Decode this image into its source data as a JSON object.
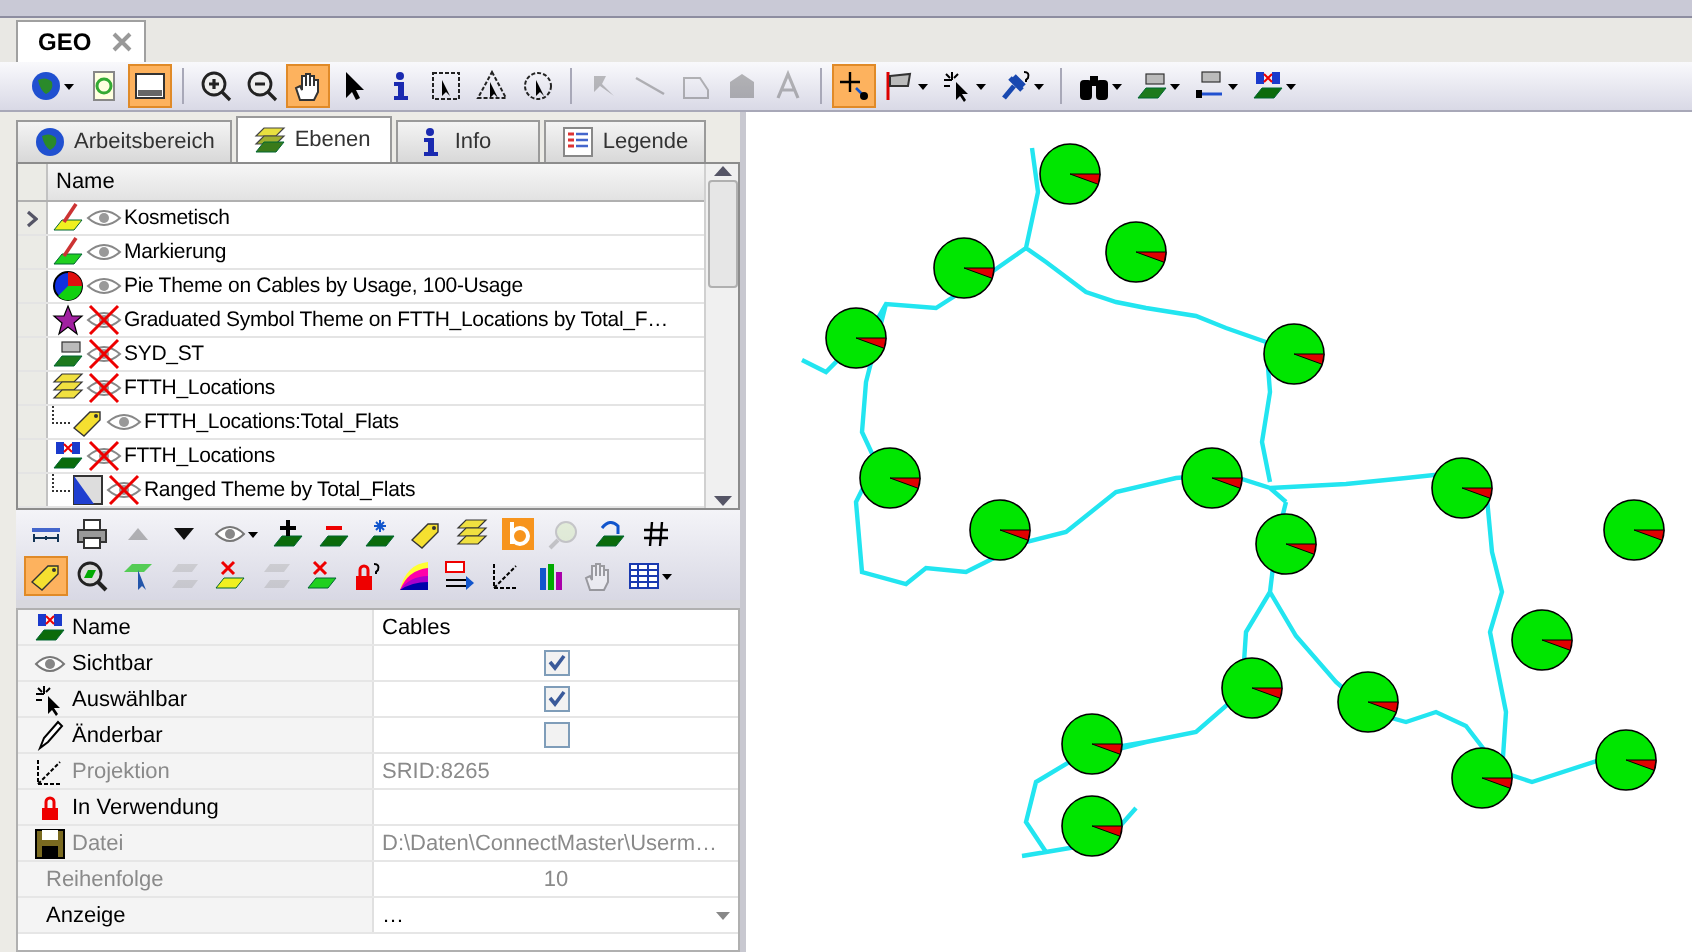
{
  "document_tab": {
    "title": "GEO",
    "selected": true
  },
  "main_toolbar": [
    {
      "kind": "globe",
      "on": false,
      "disabled": false,
      "dropdown": true
    },
    {
      "kind": "refresh",
      "on": false,
      "disabled": false,
      "dropdown": false
    },
    {
      "kind": "window",
      "on": true,
      "disabled": false,
      "dropdown": false
    },
    {
      "kind": "sep"
    },
    {
      "kind": "zoom-in",
      "on": false,
      "disabled": false,
      "dropdown": false
    },
    {
      "kind": "zoom-out",
      "on": false,
      "disabled": false,
      "dropdown": false
    },
    {
      "kind": "hand",
      "on": true,
      "disabled": false,
      "dropdown": false
    },
    {
      "kind": "pointer",
      "on": false,
      "disabled": false,
      "dropdown": false
    },
    {
      "kind": "info",
      "on": false,
      "disabled": false,
      "dropdown": false
    },
    {
      "kind": "select-rect",
      "on": false,
      "disabled": false,
      "dropdown": false
    },
    {
      "kind": "select-polygon",
      "on": false,
      "disabled": false,
      "dropdown": false
    },
    {
      "kind": "select-circle",
      "on": false,
      "disabled": false,
      "dropdown": false
    },
    {
      "kind": "sep"
    },
    {
      "kind": "pushpin",
      "on": false,
      "disabled": true,
      "dropdown": false
    },
    {
      "kind": "line",
      "on": false,
      "disabled": true,
      "dropdown": false
    },
    {
      "kind": "polyline",
      "on": false,
      "disabled": true,
      "dropdown": false
    },
    {
      "kind": "polygon",
      "on": false,
      "disabled": true,
      "dropdown": false
    },
    {
      "kind": "letter",
      "on": false,
      "disabled": true,
      "dropdown": false
    },
    {
      "kind": "sep"
    },
    {
      "kind": "crosshair",
      "on": true,
      "disabled": false,
      "dropdown": false
    },
    {
      "kind": "flag",
      "on": false,
      "disabled": false,
      "dropdown": true
    },
    {
      "kind": "sparkle-cursor",
      "on": false,
      "disabled": false,
      "dropdown": true
    },
    {
      "kind": "pushpin-query",
      "on": false,
      "disabled": false,
      "dropdown": true
    },
    {
      "kind": "sep"
    },
    {
      "kind": "binoculars",
      "on": false,
      "disabled": false,
      "dropdown": true
    },
    {
      "kind": "layer",
      "on": false,
      "disabled": false,
      "dropdown": true
    },
    {
      "kind": "layer-line",
      "on": false,
      "disabled": false,
      "dropdown": true
    },
    {
      "kind": "layer-node",
      "on": false,
      "disabled": false,
      "dropdown": true
    }
  ],
  "panel_tabs": [
    {
      "label": "Arbeitsbereich",
      "kind": "globe",
      "selected": false
    },
    {
      "label": "Ebenen",
      "kind": "layers",
      "selected": true
    },
    {
      "label": "Info",
      "kind": "info",
      "selected": false
    },
    {
      "label": "Legende",
      "kind": "legend",
      "selected": false
    }
  ],
  "layers": {
    "columns": [
      "Name"
    ],
    "rows": [
      {
        "name": "Kosmetisch",
        "kind": "cosmetic",
        "visible": true,
        "current": true
      },
      {
        "name": "Markierung",
        "kind": "marker",
        "visible": true,
        "current": false
      },
      {
        "name": "Pie Theme on Cables by Usage, 100-Usage",
        "kind": "pie",
        "visible": true,
        "current": false
      },
      {
        "name": "Graduated Symbol Theme on FTTH_Locations by Total_F…",
        "kind": "star",
        "visible": false,
        "current": false
      },
      {
        "name": "SYD_ST",
        "kind": "layer",
        "visible": false,
        "current": false
      },
      {
        "name": "FTTH_Locations",
        "kind": "stack",
        "visible": false,
        "current": false,
        "children": [
          {
            "name": "FTTH_Locations:Total_Flats",
            "kind": "label",
            "visible": true,
            "current": false
          }
        ]
      },
      {
        "name": "FTTH_Locations",
        "kind": "layer-node",
        "visible": false,
        "current": false,
        "children": [
          {
            "name": "Ranged Theme by Total_Flats",
            "kind": "ranged",
            "visible": false,
            "current": false
          }
        ]
      }
    ]
  },
  "layer_toolbar": [
    [
      {
        "kind": "ruler",
        "on": false,
        "disabled": false
      },
      {
        "kind": "printer",
        "on": false,
        "disabled": false
      },
      {
        "kind": "up",
        "on": false,
        "disabled": true
      },
      {
        "kind": "down",
        "on": false,
        "disabled": false
      },
      {
        "kind": "eye",
        "on": false,
        "disabled": false
      },
      {
        "kind": "layer-plus",
        "on": false,
        "disabled": false
      },
      {
        "kind": "layer-minus",
        "on": false,
        "disabled": false
      },
      {
        "kind": "layer-star",
        "on": false,
        "disabled": false
      },
      {
        "kind": "label",
        "on": false,
        "disabled": false
      },
      {
        "kind": "stack",
        "on": false,
        "disabled": false
      },
      {
        "kind": "orange-b",
        "on": false,
        "disabled": false
      },
      {
        "kind": "magnifier",
        "on": false,
        "disabled": true
      },
      {
        "kind": "layer-undo",
        "on": false,
        "disabled": false
      },
      {
        "kind": "hash",
        "on": false,
        "disabled": false
      }
    ],
    [
      {
        "kind": "label",
        "on": true,
        "disabled": false
      },
      {
        "kind": "zoom-layer",
        "on": false,
        "disabled": false
      },
      {
        "kind": "select-layer",
        "on": false,
        "disabled": false
      },
      {
        "kind": "layer-down",
        "on": false,
        "disabled": true
      },
      {
        "kind": "layer-x",
        "on": false,
        "disabled": false
      },
      {
        "kind": "layer-up",
        "on": false,
        "disabled": true
      },
      {
        "kind": "layer-x-green",
        "on": false,
        "disabled": false
      },
      {
        "kind": "lock-question",
        "on": false,
        "disabled": false
      },
      {
        "kind": "rainbow",
        "on": false,
        "disabled": false
      },
      {
        "kind": "export",
        "on": false,
        "disabled": false
      },
      {
        "kind": "projection",
        "on": false,
        "disabled": false
      },
      {
        "kind": "chart",
        "on": false,
        "disabled": false
      },
      {
        "kind": "hand",
        "on": false,
        "disabled": true
      },
      {
        "kind": "table",
        "on": false,
        "disabled": false
      }
    ]
  ],
  "properties": [
    {
      "label": "Name",
      "kind": "text",
      "value": "Cables",
      "disabled": false
    },
    {
      "label": "Sichtbar",
      "kind": "checkbox",
      "checked": true,
      "disabled": false
    },
    {
      "label": "Auswählbar",
      "kind": "checkbox",
      "checked": true,
      "disabled": false
    },
    {
      "label": "Änderbar",
      "kind": "checkbox",
      "checked": false,
      "disabled": false
    },
    {
      "label": "Projektion",
      "kind": "text",
      "value": "SRID:8265",
      "disabled": true
    },
    {
      "label": "In Verwendung",
      "kind": "text",
      "disabled": false
    },
    {
      "label": "Datei",
      "kind": "text",
      "value": "D:\\Daten\\ConnectMaster\\Userm…",
      "disabled": true
    },
    {
      "label": "Reihenfolge",
      "kind": "number",
      "value": "10",
      "disabled": true
    },
    {
      "label": "Anzeige",
      "kind": "dropdown",
      "value": "…",
      "disabled": false
    }
  ]
}
